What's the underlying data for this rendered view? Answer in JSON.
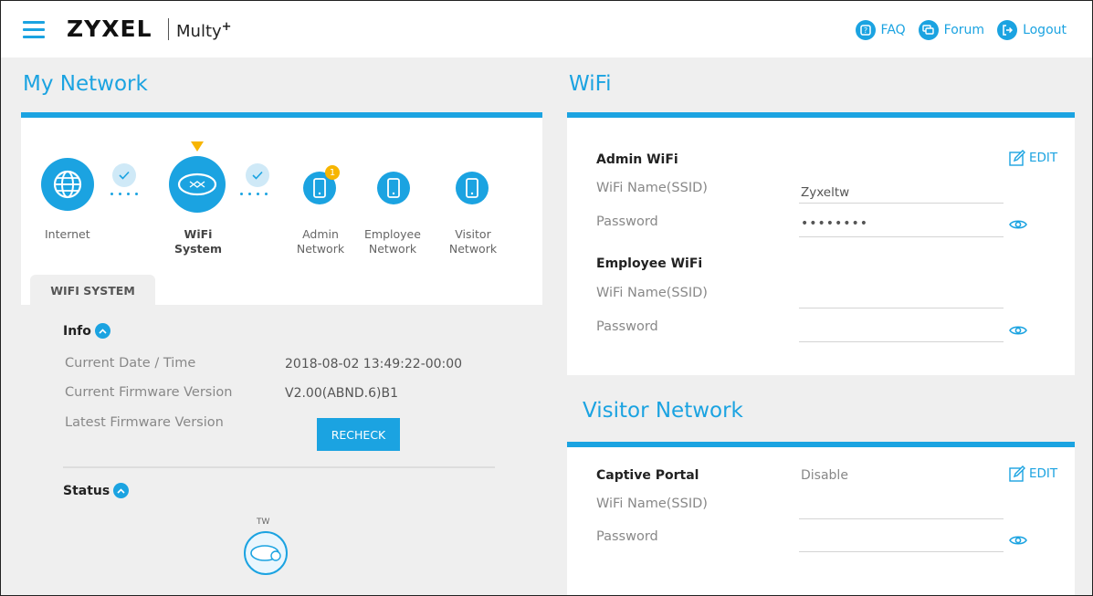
{
  "header": {
    "brand": "ZYXEL",
    "product": "Multy",
    "product_sup": "+",
    "links": [
      {
        "label": "FAQ",
        "icon": "faq-icon"
      },
      {
        "label": "Forum",
        "icon": "forum-icon"
      },
      {
        "label": "Logout",
        "icon": "logout-icon"
      }
    ]
  },
  "my_network": {
    "title": "My Network",
    "nodes": [
      {
        "label_line1": "Internet",
        "label_line2": "",
        "icon": "globe-icon"
      },
      {
        "label_line1": "WiFi",
        "label_line2": "System",
        "icon": "router-icon",
        "selected": true
      },
      {
        "label_line1": "Admin",
        "label_line2": "Network",
        "icon": "phone-icon",
        "badge": "1"
      },
      {
        "label_line1": "Employee",
        "label_line2": "Network",
        "icon": "phone-icon"
      },
      {
        "label_line1": "Visitor",
        "label_line2": "Network",
        "icon": "phone-icon"
      }
    ],
    "tab": "WIFI SYSTEM",
    "info": {
      "heading": "Info",
      "rows": [
        {
          "label": "Current Date / Time",
          "value": "2018-08-02 13:49:22-00:00"
        },
        {
          "label": "Current Firmware Version",
          "value": "V2.00(ABND.6)B1"
        },
        {
          "label": "Latest Firmware Version",
          "value": ""
        }
      ],
      "recheck_label": "RECHECK"
    },
    "status": {
      "heading": "Status",
      "device_label": "TW"
    }
  },
  "wifi": {
    "title": "WiFi",
    "admin": {
      "heading": "Admin WiFi",
      "edit_label": "EDIT",
      "ssid_label": "WiFi Name(SSID)",
      "ssid_value": "Zyxeltw",
      "password_label": "Password",
      "password_value": "••••••••"
    },
    "employee": {
      "heading": "Employee WiFi",
      "ssid_label": "WiFi Name(SSID)",
      "ssid_value": "",
      "password_label": "Password",
      "password_value": ""
    }
  },
  "visitor": {
    "title": "Visitor Network",
    "captive_portal_label": "Captive Portal",
    "captive_portal_value": "Disable",
    "edit_label": "EDIT",
    "ssid_label": "WiFi Name(SSID)",
    "ssid_value": "",
    "password_label": "Password",
    "password_value": ""
  },
  "colors": {
    "accent": "#1ba3e1",
    "badge": "#f7b500",
    "background": "#efefef"
  }
}
